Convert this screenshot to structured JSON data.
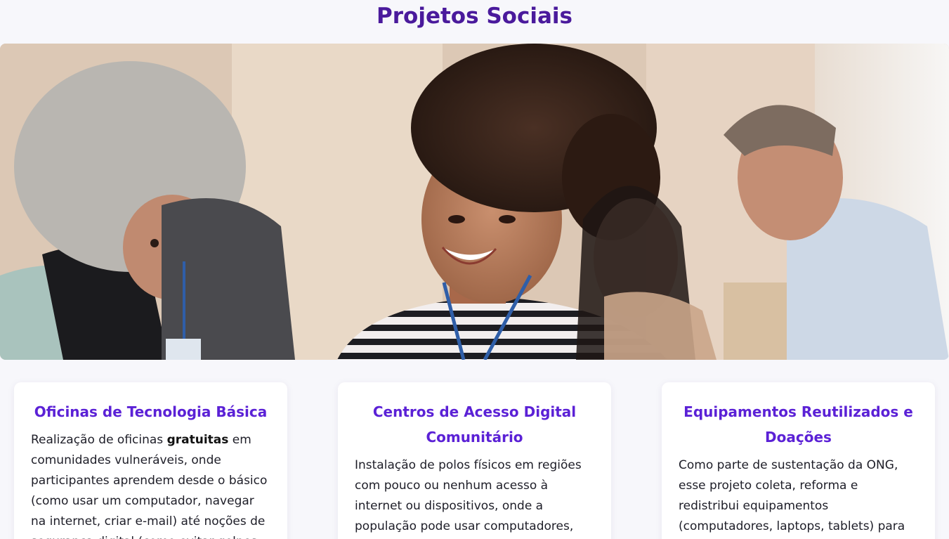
{
  "page": {
    "title": "Projetos Sociais"
  },
  "hero": {
    "alt": "Pessoas sorrindo em um espaço comunitário"
  },
  "cards": [
    {
      "title": "Oficinas de Tecnologia Básica",
      "text_before": "Realização de oficinas ",
      "text_bold": "gratuitas",
      "text_after": " em comunidades vulneráveis, onde participantes aprendem desde o básico (como usar um computador, navegar na internet, criar e-mail) até noções de segurança digital (como evitar golpes"
    },
    {
      "title": "Centros de Acesso Digital Comunitário",
      "text": "Instalação de polos físicos em regiões com pouco ou nenhum acesso à internet ou dispositivos, onde a população pode usar computadores, internet e participar de"
    },
    {
      "title": "Equipamentos Reutilizados e Doações",
      "text": "Como parte de sustentação da ONG, esse projeto coleta, reforma e redistribui equipamentos (computadores, laptops, tablets) para as comunidades atendidas ou"
    }
  ],
  "colors": {
    "title": "#4a1a9c",
    "card_title": "#5b21d6",
    "background": "#f7f7fb"
  }
}
